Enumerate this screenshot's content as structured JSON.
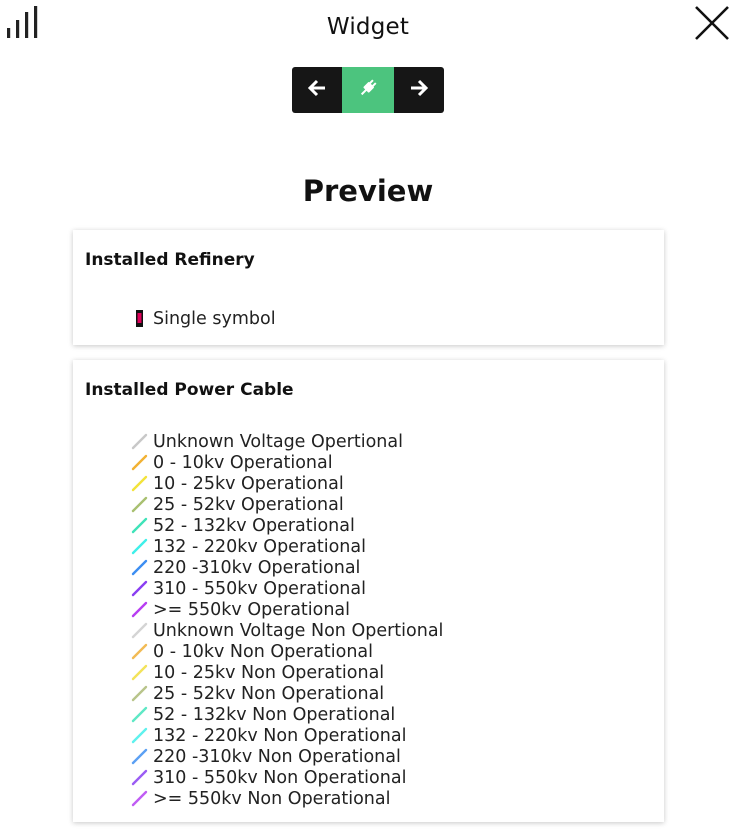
{
  "header": {
    "title": "Widget",
    "left_icon": "bar-chart-icon",
    "close_icon": "close-icon"
  },
  "toolbar": {
    "buttons": [
      {
        "icon": "arrow-left-icon",
        "bg": "#161616"
      },
      {
        "icon": "plug-icon",
        "bg": "#4cc47e"
      },
      {
        "icon": "arrow-right-icon",
        "bg": "#161616"
      }
    ]
  },
  "preview": {
    "heading": "Preview",
    "layers": [
      {
        "title": "Installed Refinery",
        "items": [
          {
            "label": "Single symbol",
            "symbol": "marker",
            "color": "#e0005a"
          }
        ]
      },
      {
        "title": "Installed Power Cable",
        "items": [
          {
            "label": "Unknown Voltage Opertional",
            "symbol": "line",
            "color": "#c8c8c8"
          },
          {
            "label": "0 - 10kv Operational",
            "symbol": "line",
            "color": "#f2b233"
          },
          {
            "label": "10 - 25kv Operational",
            "symbol": "line",
            "color": "#f3e33a"
          },
          {
            "label": "25 - 52kv Operational",
            "symbol": "line",
            "color": "#a8c070"
          },
          {
            "label": "52 - 132kv Operational",
            "symbol": "line",
            "color": "#3fe3b9"
          },
          {
            "label": "132 - 220kv Operational",
            "symbol": "line",
            "color": "#3ff0ea"
          },
          {
            "label": "220 -310kv Operational",
            "symbol": "line",
            "color": "#3c8ef2"
          },
          {
            "label": "310 - 550kv Operational",
            "symbol": "line",
            "color": "#8a3ef2"
          },
          {
            "label": ">= 550kv Operational",
            "symbol": "line",
            "color": "#b73ef2"
          },
          {
            "label": "Unknown Voltage Non Opertional",
            "symbol": "line",
            "color": "#d4d4d4"
          },
          {
            "label": "0 - 10kv Non Operational",
            "symbol": "line",
            "color": "#f2bb55"
          },
          {
            "label": "10 - 25kv Non Operational",
            "symbol": "line",
            "color": "#f3e35a"
          },
          {
            "label": "25 - 52kv Non Operational",
            "symbol": "line",
            "color": "#b8c48a"
          },
          {
            "label": "52 - 132kv Non Operational",
            "symbol": "line",
            "color": "#5fe8c5"
          },
          {
            "label": "132 - 220kv Non Operational",
            "symbol": "line",
            "color": "#5ff2ee"
          },
          {
            "label": "220 -310kv Non Operational",
            "symbol": "line",
            "color": "#5ba0f4"
          },
          {
            "label": "310 - 550kv Non Operational",
            "symbol": "line",
            "color": "#9b5cf4"
          },
          {
            "label": ">= 550kv Non Operational",
            "symbol": "line",
            "color": "#c05cf4"
          }
        ]
      }
    ]
  }
}
